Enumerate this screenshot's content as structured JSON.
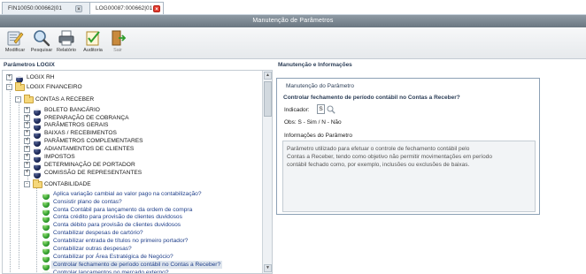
{
  "tabs": [
    {
      "label": "FIN10050:000662|01",
      "active": false
    },
    {
      "label": "LOG00087:000662|01",
      "active": true
    }
  ],
  "window": {
    "title": "Manutenção de Parâmetros"
  },
  "toolbar": {
    "modificar": "Modificar",
    "pesquisar": "Pesquisar",
    "relatorio": "Relatório",
    "auditoria": "Auditoria",
    "sair": "Sair"
  },
  "left": {
    "header": "Parâmetros LOGIX",
    "tree": [
      {
        "label": "LOGIX RH",
        "icon": "navy-ball-icon",
        "expander": "+"
      },
      {
        "label": "LOGIX FINANCEIRO",
        "icon": "folder-icon",
        "expander": "-"
      },
      {
        "label": "CONTAS A RECEBER",
        "icon": "folder-icon",
        "expander": "-"
      },
      {
        "label": "BOLETO BANCÁRIO",
        "icon": "navy-ball-icon",
        "expander": "+"
      },
      {
        "label": "PREPARAÇÃO DE COBRANÇA",
        "icon": "navy-ball-icon",
        "expander": "+"
      },
      {
        "label": "PARÂMETROS GERAIS",
        "icon": "navy-ball-icon",
        "expander": "+"
      },
      {
        "label": "BAIXAS / RECEBIMENTOS",
        "icon": "navy-ball-icon",
        "expander": "+"
      },
      {
        "label": "PARÂMETROS COMPLEMENTARES",
        "icon": "navy-ball-icon",
        "expander": "+"
      },
      {
        "label": "ADIANTAMENTOS DE CLIENTES",
        "icon": "navy-ball-icon",
        "expander": "+"
      },
      {
        "label": "IMPOSTOS",
        "icon": "navy-ball-icon",
        "expander": "+"
      },
      {
        "label": "DETERMINAÇÃO DE PORTADOR",
        "icon": "navy-ball-icon",
        "expander": "+"
      },
      {
        "label": "COMISSÃO DE REPRESENTANTES",
        "icon": "navy-ball-icon",
        "expander": "+"
      },
      {
        "label": "CONTABILIDADE",
        "icon": "folder-icon",
        "expander": "-"
      },
      {
        "label": "Aplica variação cambial ao valor pago na contabilização?",
        "icon": "green-ball-icon"
      },
      {
        "label": "Consistir plano de contas?",
        "icon": "green-ball-icon"
      },
      {
        "label": "Conta Contábil para lançamento da ordem de compra",
        "icon": "green-ball-icon"
      },
      {
        "label": "Conta crédito para provisão de clientes duvidosos",
        "icon": "green-ball-icon"
      },
      {
        "label": "Conta débito para provisão de clientes duvidosos",
        "icon": "green-ball-icon"
      },
      {
        "label": "Contabilizar despesas de cartório?",
        "icon": "green-ball-icon"
      },
      {
        "label": "Contabilizar entrada de títulos no primeiro portador?",
        "icon": "green-ball-icon"
      },
      {
        "label": "Contabilizar outras despesas?",
        "icon": "green-ball-icon"
      },
      {
        "label": "Contabilizar por Área Estratégica de Negócio?",
        "icon": "green-ball-icon"
      },
      {
        "label": "Controlar fechamento de período contábil no Contas a Receber?",
        "icon": "green-ball-icon",
        "selected": true
      },
      {
        "label": "Controlar lançamentos no mercado externo?",
        "icon": "green-ball-icon"
      }
    ]
  },
  "right": {
    "header": "Manutenção e Informações",
    "group_title": "Manutenção do Parâmetro",
    "question": "Controlar fechamento de período contábil no Contas a Receber?",
    "indicator_label": "Indicador:",
    "indicator_value": "S",
    "obs": "Obs: S - Sim / N - Não",
    "info_title": "Informações do Parâmetro",
    "info_lines": [
      "Parâmetro utilizado para efetuar o controle de fechamento contábil pelo",
      "Contas a Receber, tendo como objetivo não permitir movimentações em período",
      "contábil fechado como, por exemplo, inclusões ou exclusões de baixas."
    ]
  },
  "colors": {
    "titlebar": "#6b7781",
    "header_text": "#2c3e57",
    "link_text": "#1f3f8a",
    "close_tab": "#e23b2e"
  }
}
